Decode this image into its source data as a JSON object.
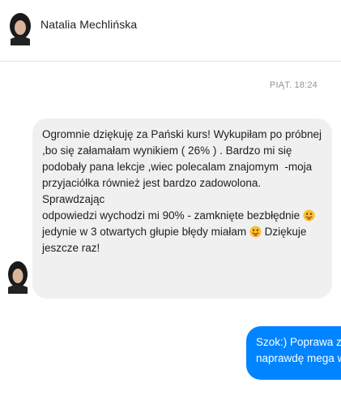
{
  "header": {
    "contact_name": "Natalia Mechlińska",
    "avatar_icon": "profile-photo-icon"
  },
  "timestamp": "PIĄT. 18:24",
  "incoming_message": {
    "line_1": "Ogromnie dziękuję za Pański kurs! Wykupiłam po próbnej",
    "line_2": ",bo się załamałam wynikiem ( 26% ) . Bardzo mi się",
    "line_3": "podobały pana lekcje ,wiec polecalam znajomym  -moja",
    "line_4": "przyjaciółka również jest bardzo zadowolona. Sprawdzając",
    "line_5_text": "odpowiedzi wychodzi mi 90% - zamknięte bezbłędnie ",
    "line_6_text_a": "jedynie w 3 otwartych głupie błędy miałam ",
    "line_6_text_b": " Dziękuje",
    "line_7": "jeszcze raz!",
    "emoji_icon": "tongue-out-emoji-icon"
  },
  "outgoing_message": {
    "line_1": "Szok:) Poprawa z",
    "line_2": "naprawdę mega w"
  },
  "colors": {
    "incoming_bubble": "#f1f0f0",
    "outgoing_bubble": "#0084ff",
    "timestamp": "#90949c"
  }
}
